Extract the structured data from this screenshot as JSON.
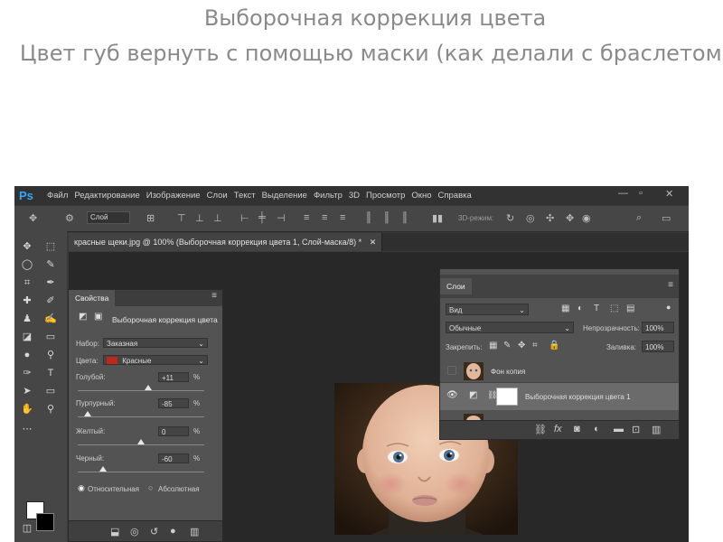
{
  "slide": {
    "title": "Выборочная коррекция цвета",
    "subtitle": "Цвет губ вернуть с помощью маски (как делали с браслетом)"
  },
  "app": {
    "logo": "Ps",
    "menu": [
      "Файл",
      "Редактирование",
      "Изображение",
      "Слои",
      "Текст",
      "Выделение",
      "Фильтр",
      "3D",
      "Просмотр",
      "Окно",
      "Справка"
    ],
    "window_controls": [
      "—",
      "▫",
      "✕"
    ],
    "options": {
      "layer_select": "Слой",
      "mode_3d": "3D-режим:"
    },
    "doc_tab": "красные щеки.jpg @ 100% (Выборочная коррекция цвета 1, Слой-маска/8) *",
    "doc_close": "✕"
  },
  "properties": {
    "tab": "Свойства",
    "title": "Выборочная коррекция цвета",
    "preset_label": "Набор:",
    "preset_value": "Заказная",
    "colors_label": "Цвета:",
    "colors_value": "Красные",
    "colors_swatch": "#c0271c",
    "sliders": [
      {
        "label": "Голубой:",
        "value": "+11",
        "unit": "%",
        "level": 0.555
      },
      {
        "label": "Пурпурный:",
        "value": "-85",
        "unit": "%",
        "level": 0.075
      },
      {
        "label": "Желтый:",
        "value": "0",
        "unit": "%",
        "level": 0.5
      },
      {
        "label": "Черный:",
        "value": "-60",
        "unit": "%",
        "level": 0.2
      }
    ],
    "radio_relative": "Относительная",
    "radio_absolute": "Абсолютная"
  },
  "layers": {
    "tab": "Слои",
    "filter_value": "Вид",
    "blend_mode": "Обычные",
    "opacity_label": "Непрозрачность:",
    "opacity_value": "100%",
    "lock_label": "Закрепить:",
    "fill_label": "Заливка:",
    "fill_value": "100%",
    "items": [
      {
        "name": "Фон копия"
      },
      {
        "name": "Выборочная коррекция цвета 1"
      }
    ]
  }
}
